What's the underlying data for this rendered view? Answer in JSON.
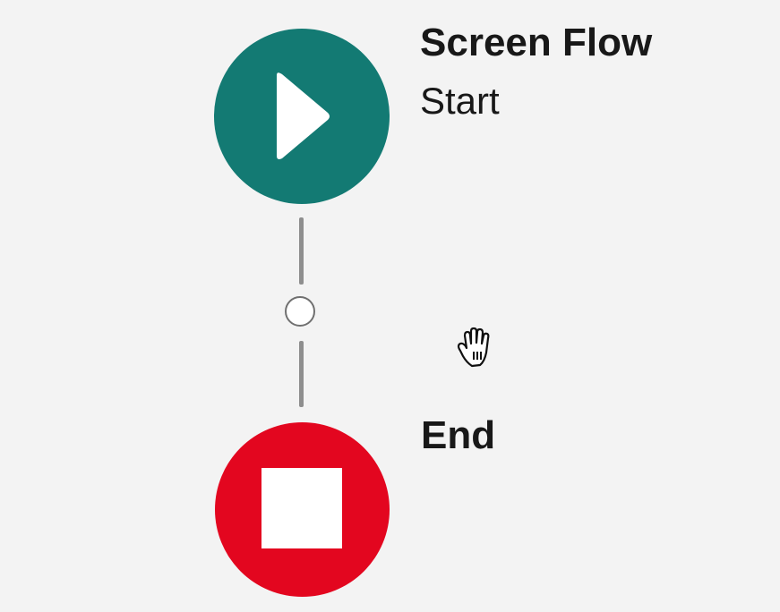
{
  "flow": {
    "start": {
      "title": "Screen Flow",
      "subtitle": "Start",
      "icon": "play-icon",
      "color": "#137a73"
    },
    "end": {
      "title": "End",
      "icon": "stop-icon",
      "color": "#e3061f"
    },
    "connector_color": "#8e8e8e",
    "cursor_icon": "grab-hand-cursor-icon"
  }
}
